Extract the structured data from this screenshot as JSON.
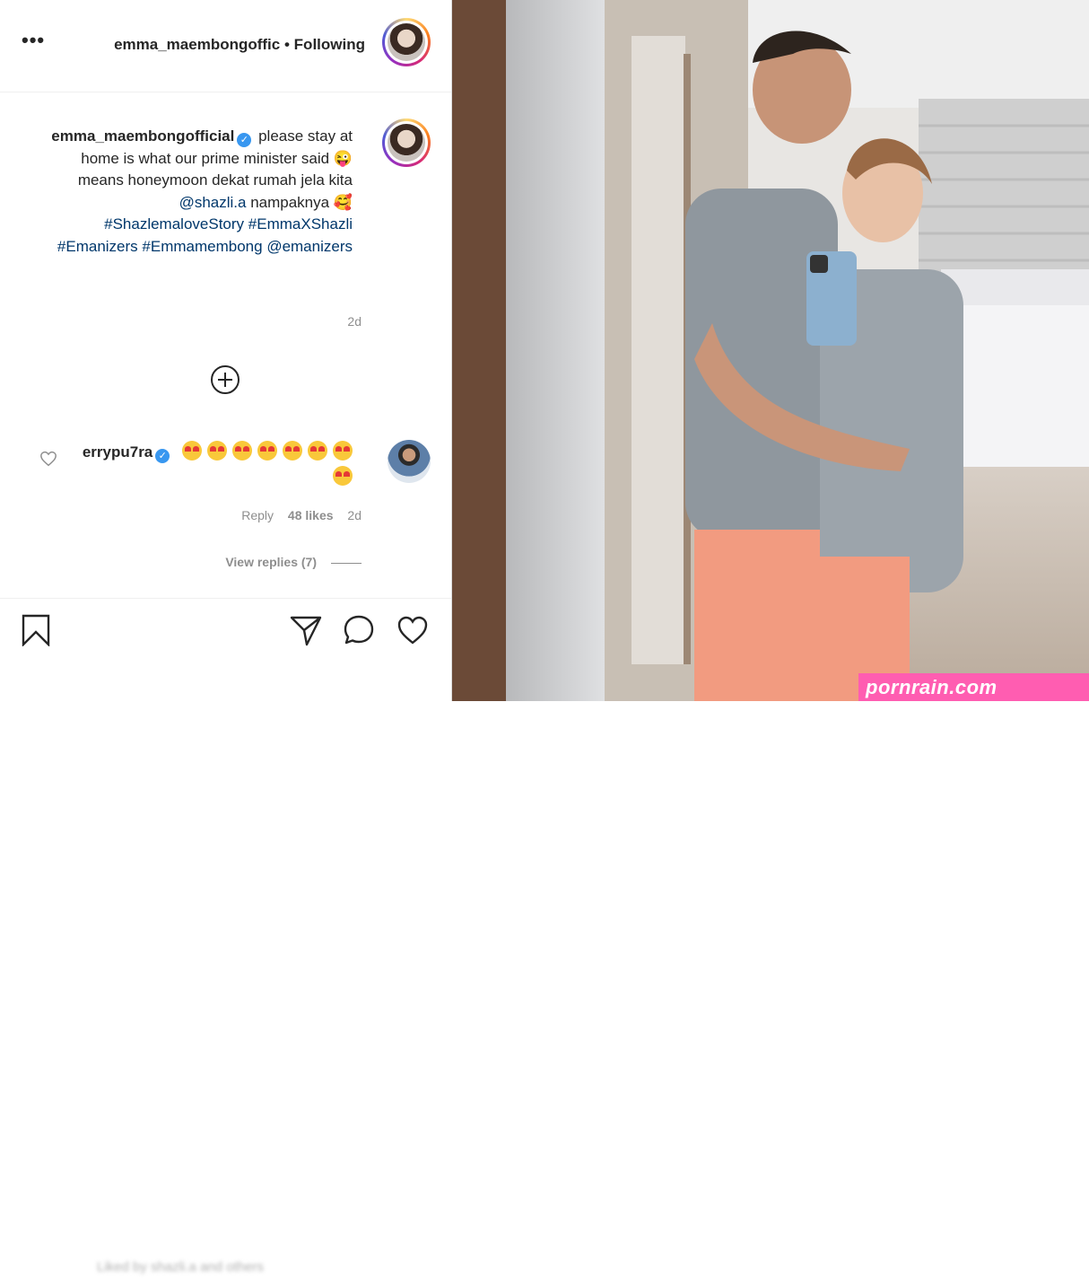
{
  "header": {
    "username": "emma_maembongoffic",
    "separator": "•",
    "follow_status": "Following",
    "more": "•••"
  },
  "caption": {
    "username": "emma_maembongofficial",
    "text_1": "please stay at home is what our prime minister said",
    "text_2": "means honeymoon dekat rumah jela kita",
    "mention_1": "@shazli.a",
    "text_3": "nampaknya",
    "hashtag_1": "#ShazlemaloveStory",
    "hashtag_2": "#EmmaXShazli",
    "hashtag_3": "#Emanizers",
    "hashtag_4": "#Emmamembong",
    "mention_2": "@emanizers",
    "time": "2d"
  },
  "comment": {
    "username": "errypu7ra",
    "emoji_count": 8,
    "time": "2d",
    "likes": "48 likes",
    "reply": "Reply",
    "view_replies": "View replies (7)"
  },
  "footer": {
    "blurred_text": "Liked by shazli.a and others"
  },
  "watermark": "pornrain.com",
  "colors": {
    "link": "#00376b",
    "verified": "#3897f0",
    "muted": "#8e8e8e",
    "watermark_bg": "#ff5db1"
  }
}
